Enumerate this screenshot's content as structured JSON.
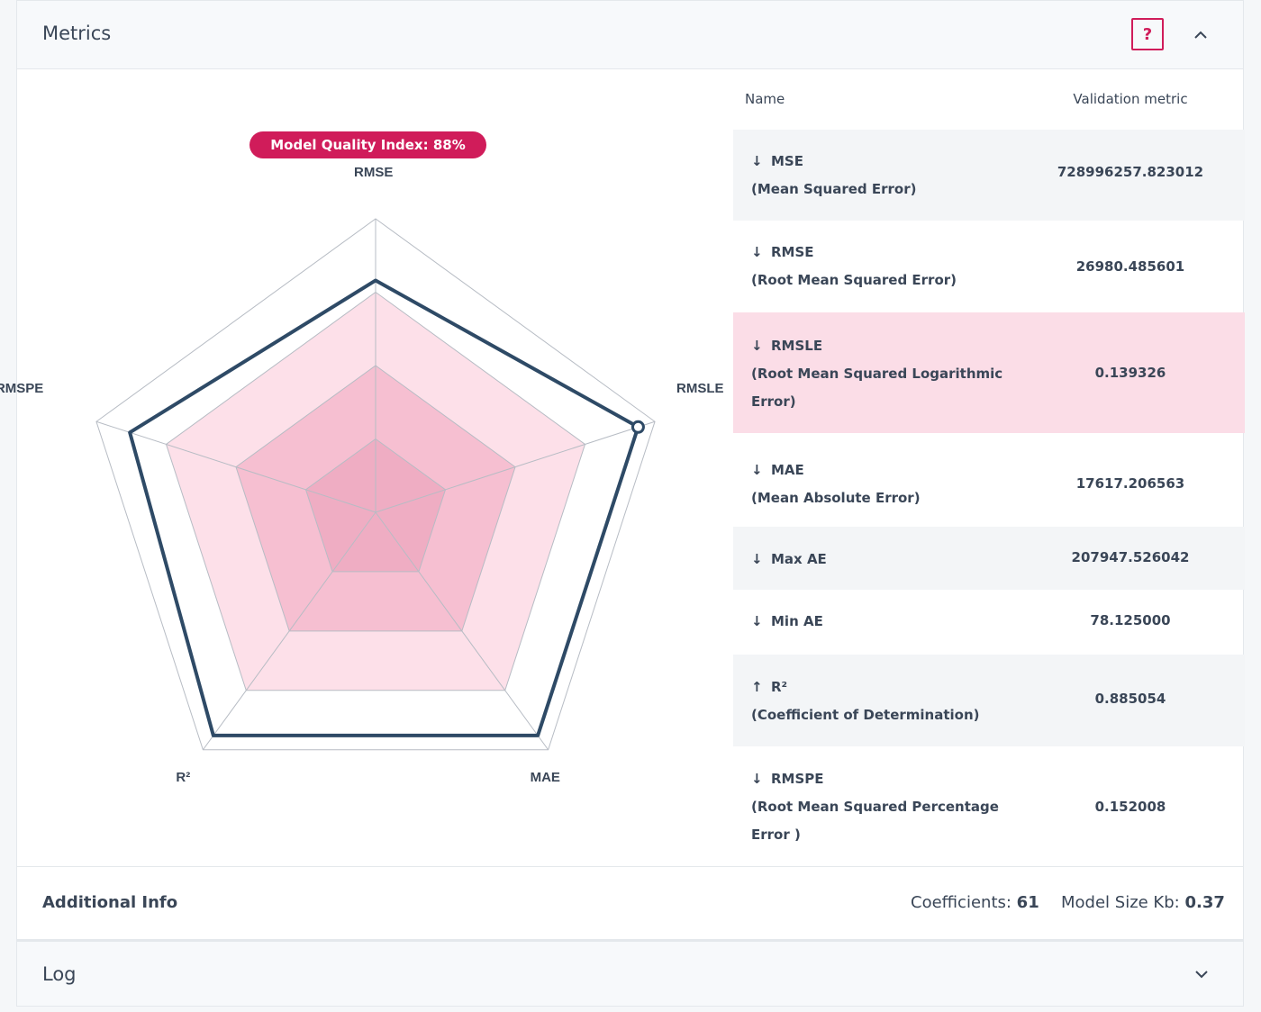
{
  "metrics_panel": {
    "title": "Metrics",
    "help_label": "?",
    "accent_color": "#d01c5a"
  },
  "chart_data": {
    "type": "radar",
    "badge": "Model Quality Index: 88%",
    "axes": [
      "RMSE",
      "RMSLE",
      "MAE",
      "R²",
      "RMSPE"
    ],
    "series": [
      {
        "values": [
          0.79,
          0.94,
          0.94,
          0.94,
          0.88
        ]
      }
    ],
    "bands": [
      0.25,
      0.5,
      0.75
    ],
    "highlighted_axis": "RMSLE",
    "colors": {
      "line": "#2e4a66",
      "fill": "#f7b8cc",
      "grid": "#b7bcc4"
    }
  },
  "table": {
    "headers": {
      "name": "Name",
      "value": "Validation metric"
    },
    "rows": [
      {
        "arrow": "↓",
        "name": "MSE",
        "desc": "(Mean Squared Error)",
        "value": "728996257.823012"
      },
      {
        "arrow": "↓",
        "name": "RMSE",
        "desc": "(Root Mean Squared Error)",
        "value": "26980.485601"
      },
      {
        "arrow": "↓",
        "name": "RMSLE",
        "desc": "(Root Mean Squared Logarithmic Error)",
        "value": "0.139326"
      },
      {
        "arrow": "↓",
        "name": "MAE",
        "desc": "(Mean Absolute Error)",
        "value": "17617.206563"
      },
      {
        "arrow": "↓",
        "name": "Max AE",
        "desc": "",
        "value": "207947.526042"
      },
      {
        "arrow": "↓",
        "name": "Min AE",
        "desc": "",
        "value": "78.125000"
      },
      {
        "arrow": "↑",
        "name": "R²",
        "desc": "(Coefficient of Determination)",
        "value": "0.885054"
      },
      {
        "arrow": "↓",
        "name": "RMSPE",
        "desc": "(Root Mean Squared Percentage Error )",
        "value": "0.152008"
      }
    ]
  },
  "additional_info": {
    "title": "Additional Info",
    "coefficients_label": "Coefficients:",
    "coefficients_value": "61",
    "model_size_label": "Model Size Kb:",
    "model_size_value": "0.37"
  },
  "log_panel": {
    "title": "Log"
  }
}
